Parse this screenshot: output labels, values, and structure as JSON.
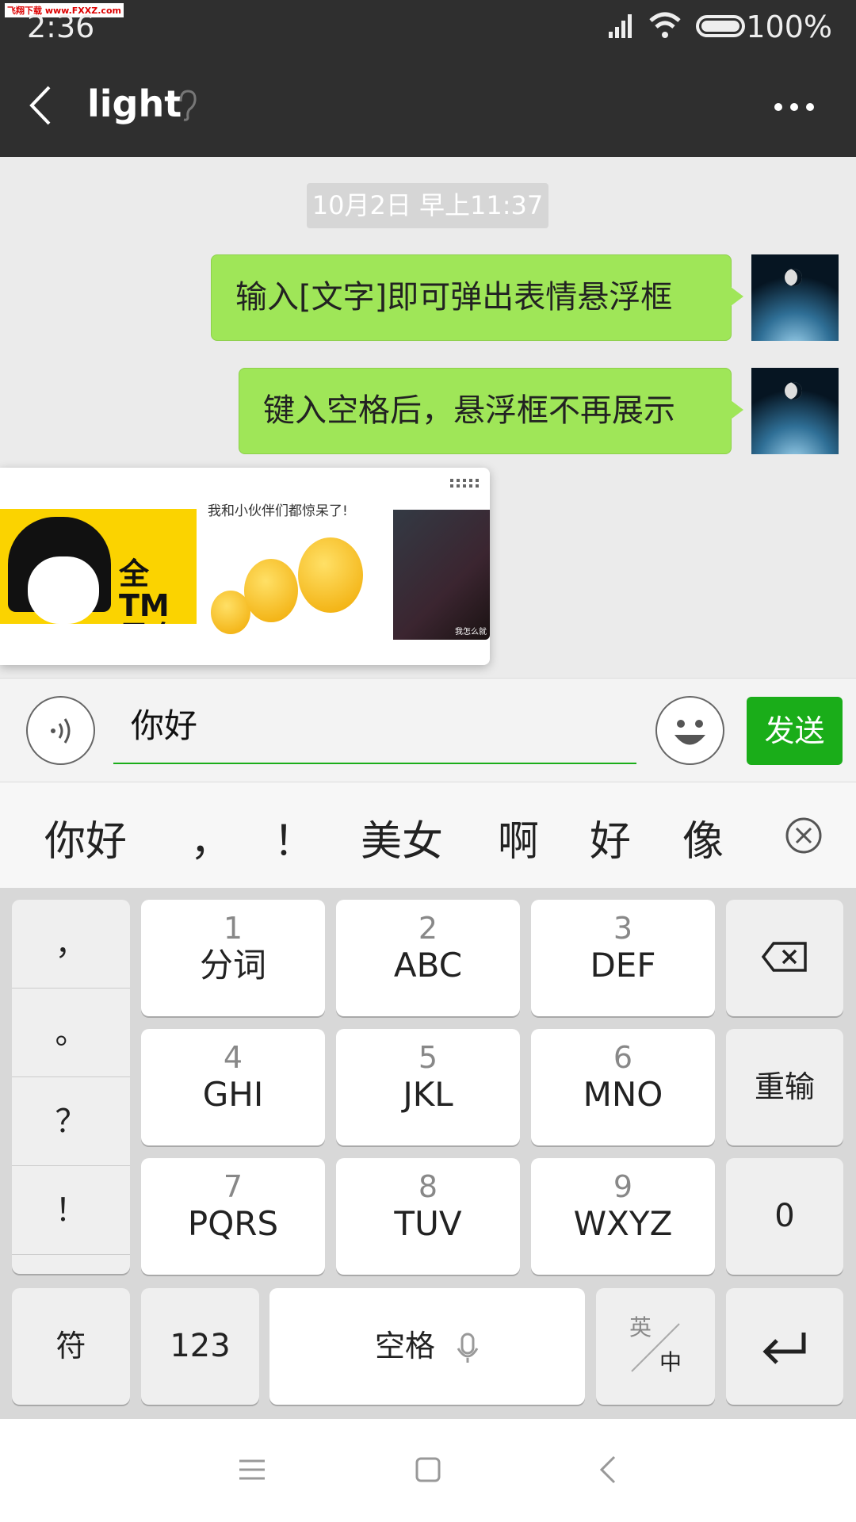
{
  "watermark": "飞翔下载 www.FXXZ.com",
  "status": {
    "time": "2:36",
    "battery": "100%",
    "icons": [
      "signal-icon",
      "wifi-icon",
      "battery-icon"
    ]
  },
  "header": {
    "title": "light",
    "back_icon": "chevron-left-icon",
    "ear_icon": "ear-icon",
    "more_icon": "more-icon"
  },
  "chat": {
    "timestamp": "10月2日 早上11:37",
    "messages": [
      {
        "text": "输入[文字]即可弹出表情悬浮框",
        "sender": "me"
      },
      {
        "text": "键入空格后，悬浮框不再展示",
        "sender": "me"
      }
    ]
  },
  "sticker_popup": {
    "stickers": [
      {
        "caption": "全TM是套路！"
      },
      {
        "caption": "我和小伙伴们都惊呆了!"
      },
      {
        "caption": "我怎么就"
      }
    ]
  },
  "input": {
    "value": "你好",
    "send_label": "发送"
  },
  "candidates": [
    "你好",
    "，",
    "！",
    "美女",
    "啊",
    "好",
    "像"
  ],
  "keyboard": {
    "punct": [
      "，",
      "。",
      "？",
      "！"
    ],
    "keys": [
      {
        "n": "1",
        "l": "分词"
      },
      {
        "n": "2",
        "l": "ABC"
      },
      {
        "n": "3",
        "l": "DEF"
      },
      {
        "n": "4",
        "l": "GHI"
      },
      {
        "n": "5",
        "l": "JKL"
      },
      {
        "n": "6",
        "l": "MNO"
      },
      {
        "n": "7",
        "l": "PQRS"
      },
      {
        "n": "8",
        "l": "TUV"
      },
      {
        "n": "9",
        "l": "WXYZ"
      }
    ],
    "reinput": "重输",
    "zero": "0",
    "symbol": "符",
    "num": "123",
    "space": "空格",
    "lang_top": "英",
    "lang_bottom": "中"
  },
  "colors": {
    "send": "#1aad19",
    "bubble": "#9fe658",
    "header": "#2f2f2f"
  }
}
